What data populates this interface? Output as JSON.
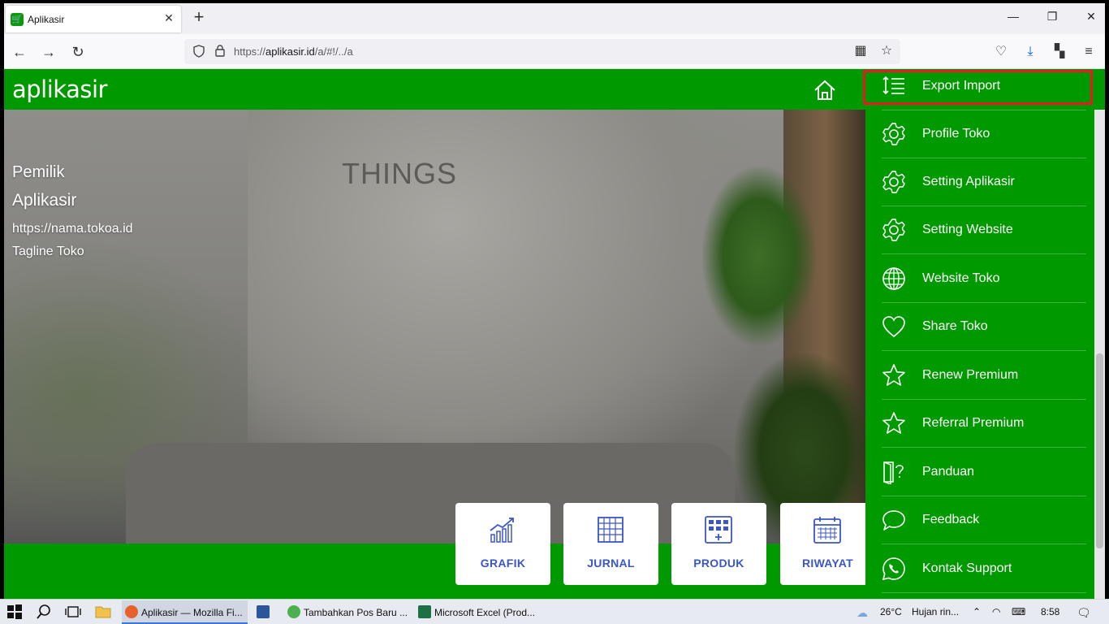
{
  "browser": {
    "tab_title": "Aplikasir",
    "tab_close": "✕",
    "new_tab": "+",
    "url_scheme": "https://",
    "url_host": "aplikasir.id",
    "url_path": "/a/#!/../a",
    "window_controls": {
      "minimize": "—",
      "restore": "❐",
      "close": "✕"
    }
  },
  "app": {
    "logo": "aplikasir",
    "hero": {
      "wall_text": "THINGS",
      "owner_label": "Pemilik",
      "store_name": "Aplikasir",
      "store_url": "https://nama.tokoa.id",
      "tagline": "Tagline Toko"
    },
    "menu_cards": [
      {
        "label": "GRAFIK",
        "icon": "chart-icon"
      },
      {
        "label": "JURNAL",
        "icon": "grid-table-icon"
      },
      {
        "label": "PRODUK",
        "icon": "product-grid-icon"
      },
      {
        "label": "RIWAYAT",
        "icon": "calendar-icon"
      }
    ]
  },
  "dropdown": {
    "items": [
      {
        "label": "Export Import",
        "icon": "sort-list-icon"
      },
      {
        "label": "Profile Toko",
        "icon": "gear-icon"
      },
      {
        "label": "Setting Aplikasir",
        "icon": "gear-icon"
      },
      {
        "label": "Setting Website",
        "icon": "gear-icon"
      },
      {
        "label": "Website Toko",
        "icon": "globe-icon"
      },
      {
        "label": "Share Toko",
        "icon": "heart-icon"
      },
      {
        "label": "Renew Premium",
        "icon": "star-icon"
      },
      {
        "label": "Referral Premium",
        "icon": "star-icon"
      },
      {
        "label": "Panduan",
        "icon": "door-question-icon"
      },
      {
        "label": "Feedback",
        "icon": "chat-bubble-icon"
      },
      {
        "label": "Kontak Support",
        "icon": "whatsapp-icon"
      }
    ]
  },
  "taskbar": {
    "tasks": [
      {
        "label": "Aplikasir — Mozilla Fi...",
        "color": "#e8602c"
      },
      {
        "label": "",
        "color": "#2b579a"
      },
      {
        "label": "Tambahkan Pos Baru ...",
        "color": "#4caf50"
      },
      {
        "label": "Microsoft Excel (Prod...",
        "color": "#1d7044"
      }
    ],
    "temperature": "26°C",
    "weather": "Hujan rin...",
    "time": "8:58"
  },
  "colors": {
    "brand_green": "#009900",
    "card_label_blue": "#3a56c8",
    "highlight_red": "#e31b23"
  }
}
